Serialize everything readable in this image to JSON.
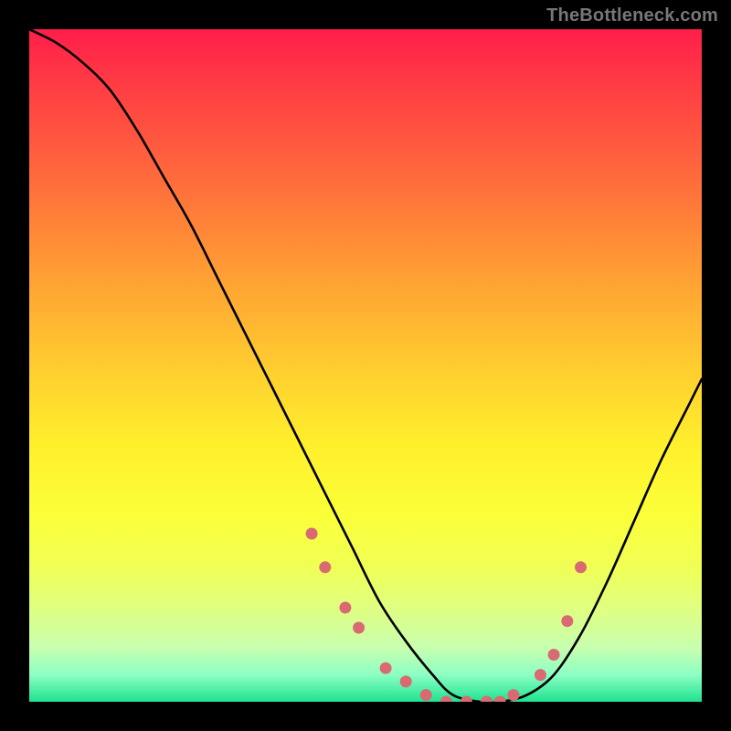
{
  "watermark": "TheBottleneck.com",
  "chart_data": {
    "type": "line",
    "title": "",
    "xlabel": "",
    "ylabel": "",
    "xlim": [
      0,
      100
    ],
    "ylim": [
      0,
      100
    ],
    "grid": false,
    "legend": false,
    "series": [
      {
        "name": "curve",
        "x": [
          0,
          4,
          8,
          12,
          16,
          20,
          24,
          28,
          32,
          36,
          40,
          44,
          48,
          52,
          56,
          60,
          63,
          67,
          70,
          74,
          78,
          82,
          86,
          90,
          94,
          98,
          100
        ],
        "y": [
          100,
          98,
          95,
          91,
          85,
          78,
          71,
          63,
          55,
          47,
          39,
          31,
          23,
          15,
          9,
          4,
          1,
          0,
          0,
          1,
          4,
          10,
          18,
          27,
          36,
          44,
          48
        ]
      },
      {
        "name": "dots",
        "x": [
          42,
          44,
          47,
          49,
          53,
          56,
          59,
          62,
          65,
          68,
          70,
          72,
          76,
          78,
          80,
          82
        ],
        "y": [
          25,
          20,
          14,
          11,
          5,
          3,
          1,
          0,
          0,
          0,
          0,
          1,
          4,
          7,
          12,
          20
        ]
      }
    ]
  }
}
